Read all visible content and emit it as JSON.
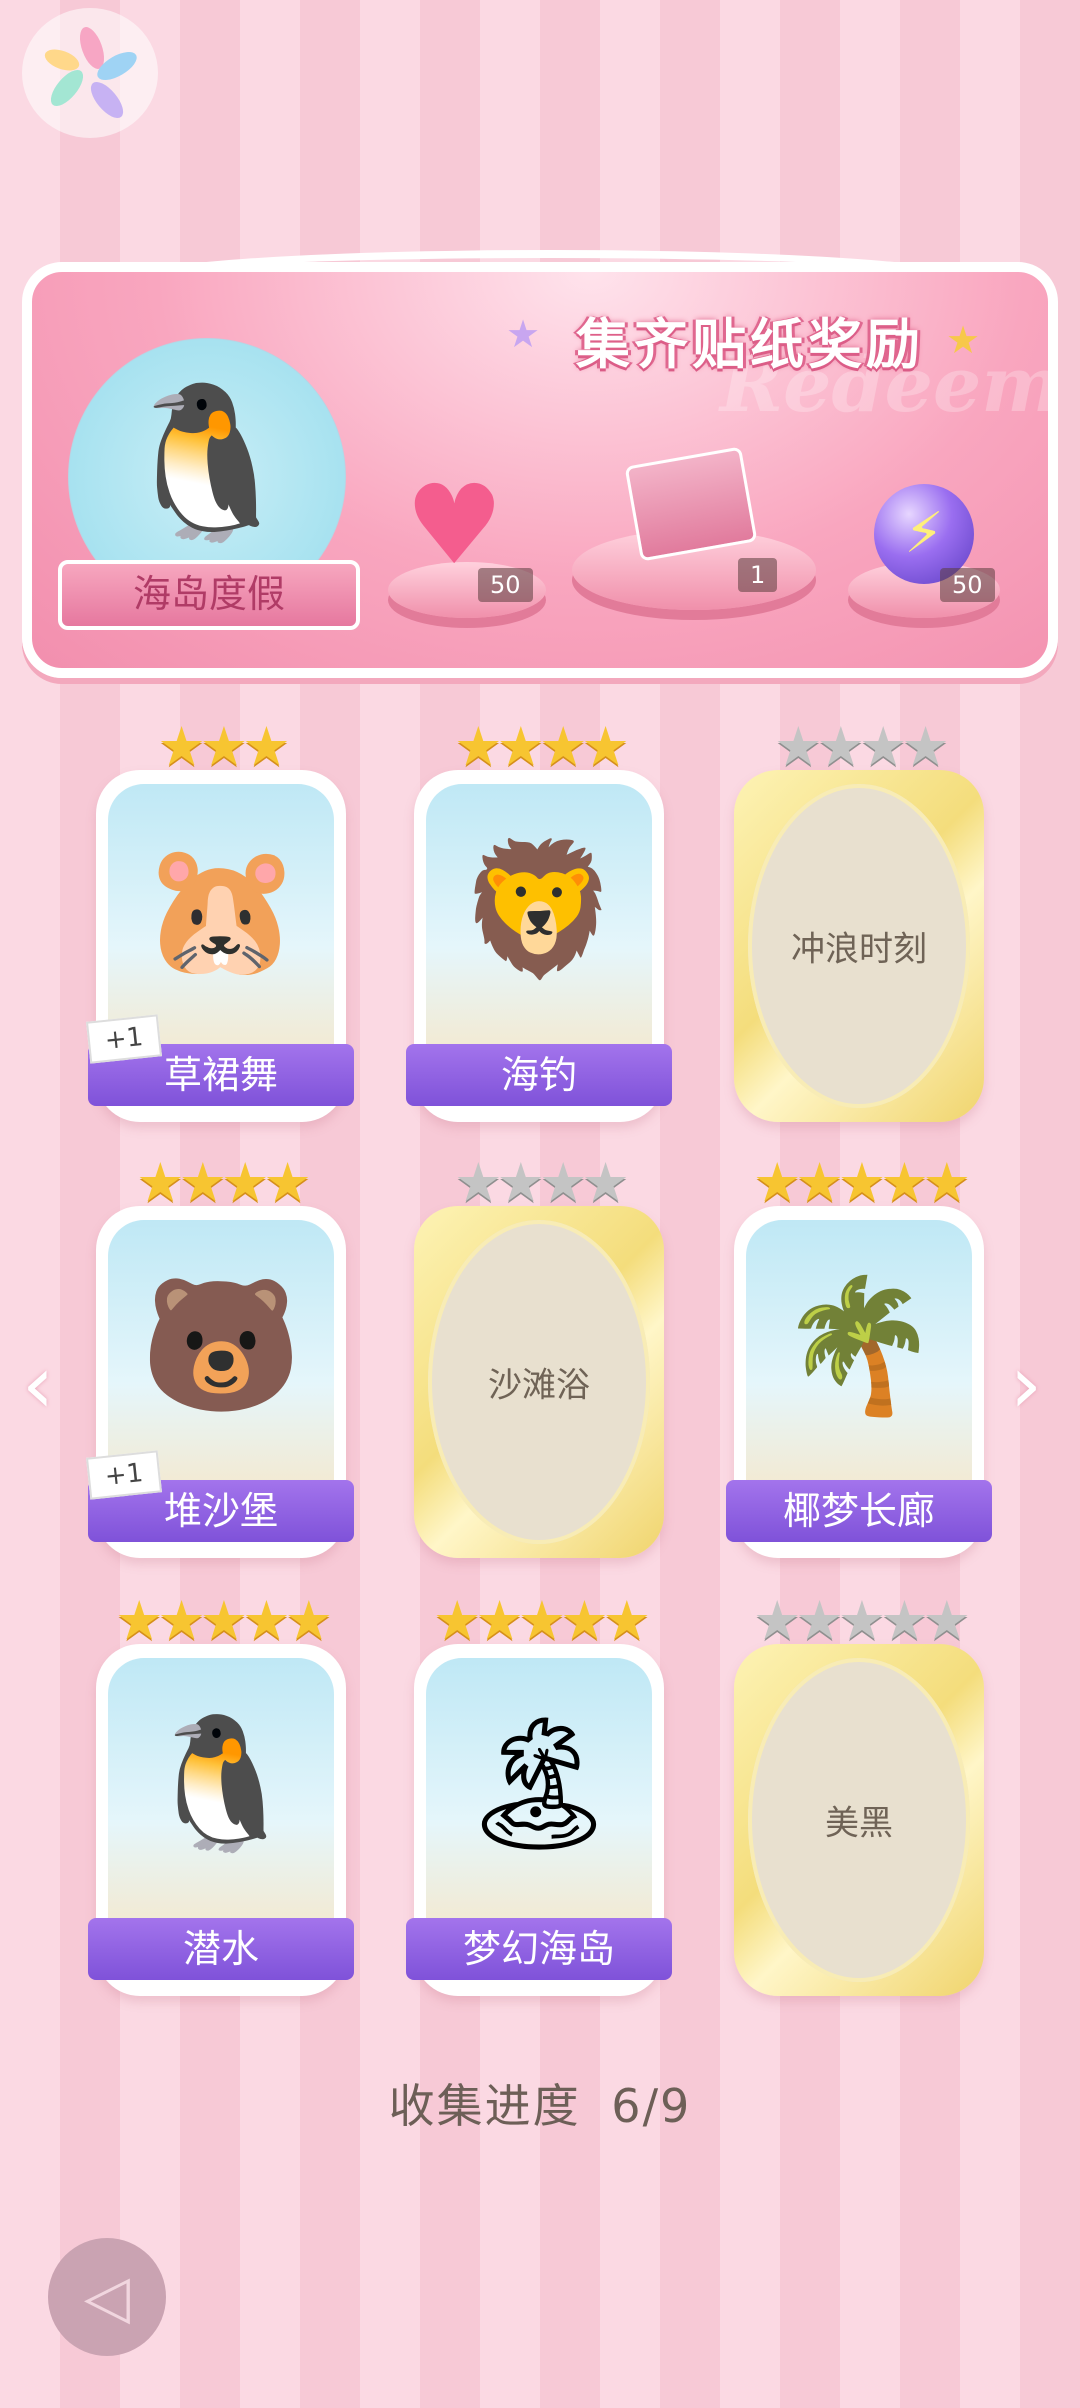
{
  "banner": {
    "title": "集齐贴纸奖励",
    "watermark": "Redeem",
    "badge_label": "海岛度假",
    "rewards": [
      {
        "icon": "pink-heart-gem-icon",
        "count": "50"
      },
      {
        "icon": "gift-box-icon",
        "count": "1"
      },
      {
        "icon": "purple-energy-orb-icon",
        "count": "50"
      }
    ]
  },
  "stickers": [
    {
      "name": "草裙舞",
      "collected": true,
      "stars": 3,
      "extra": "+1",
      "icon": "capybara-hula-icon",
      "glyph": "🐹"
    },
    {
      "name": "海钓",
      "collected": true,
      "stars": 4,
      "extra": "",
      "icon": "lion-fishing-icon",
      "glyph": "🦁"
    },
    {
      "name": "冲浪时刻",
      "collected": false,
      "stars": 4,
      "extra": ""
    },
    {
      "name": "堆沙堡",
      "collected": true,
      "stars": 4,
      "extra": "+1",
      "icon": "bear-sandcastle-icon",
      "glyph": "🐻"
    },
    {
      "name": "沙滩浴",
      "collected": false,
      "stars": 4,
      "extra": ""
    },
    {
      "name": "椰梦长廊",
      "collected": true,
      "stars": 5,
      "extra": "",
      "icon": "coconut-palms-icon",
      "glyph": "🌴"
    },
    {
      "name": "潜水",
      "collected": true,
      "stars": 5,
      "extra": "",
      "icon": "penguin-diving-icon",
      "glyph": "🐧"
    },
    {
      "name": "梦幻海岛",
      "collected": true,
      "stars": 5,
      "extra": "",
      "icon": "beach-hut-icon",
      "glyph": "🏝"
    },
    {
      "name": "美黑",
      "collected": false,
      "stars": 5,
      "extra": ""
    }
  ],
  "progress": {
    "label": "收集进度",
    "value": "6/9"
  },
  "nav": {
    "prev_icon": "chevron-left-icon",
    "next_icon": "chevron-right-icon",
    "back_icon": "back-arrow-icon"
  },
  "colors": {
    "ribbon": "#8f5fe0",
    "star_gold": "#f7c531",
    "star_gray": "#c4c4c4",
    "banner_pink": "#f28fae"
  }
}
